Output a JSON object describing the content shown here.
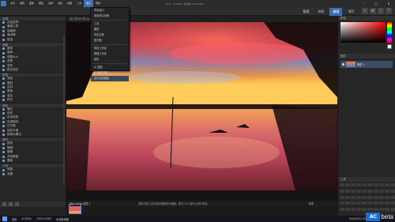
{
  "menu": {
    "items": [
      "文件",
      "编辑",
      "图像",
      "图层",
      "选择",
      "滤镜",
      "视图",
      "工具",
      "窗口",
      "帮助"
    ],
    "active_index": 8,
    "title": "ACD · ACDSee 专业版 2024 beta"
  },
  "window_controls": [
    "–",
    "□",
    "✕"
  ],
  "mode_tabs": [
    "管理",
    "冲印",
    "编辑",
    "365"
  ],
  "mode_active": 2,
  "left_panel": {
    "sections": [
      {
        "label": "选择",
        "rows": [
          "自由选择",
          "套索工具",
          "智能刷",
          "魔术棒",
          "框选"
        ]
      },
      {
        "label": "调整",
        "rows": [
          "裁剪",
          "旋转",
          "调整大小",
          "透视",
          "变形",
          "镜头校正"
        ]
      },
      {
        "label": "图层",
        "rows": [
          "添加",
          "复制",
          "合并",
          "蒙版",
          "混合",
          "样式"
        ]
      },
      {
        "label": "颜色",
        "rows": [
          "曝光",
          "色阶",
          "自动色阶",
          "色调曲线",
          "白平衡",
          "色彩平衡",
          "转换为黑白"
        ]
      },
      {
        "label": "细节",
        "rows": [
          "锐化",
          "降噪",
          "模糊",
          "去除雾霾",
          "晕影"
        ]
      },
      {
        "label": "几何",
        "rows": [
          "修复",
          "克隆"
        ]
      }
    ]
  },
  "window_menu": {
    "items": [
      "停靠窗口",
      "恢复默认布局",
      "工具",
      "图层",
      "历史记录",
      "直方图",
      "保存工作区",
      "管理工作区",
      "颜色",
      "Al 智能",
      "Al 面部识别",
      "显示全部面板"
    ]
  },
  "canvas": {
    "caption": "星空湖泊日落.jpg",
    "status_left": "显示 100%  图层 1",
    "status_mid": "选择左侧工具开始对图像进行编辑。按住 Ctrl 键可以进行多选。",
    "status_right": "完成"
  },
  "right_panel": {
    "color_header": "颜色",
    "layers_header": "图层",
    "layer_name": "图层 1",
    "tools_header": "工具"
  },
  "taskbar": {
    "items": [
      "搜索",
      "ACDSee",
      "1920×1080",
      "资源管理器"
    ],
    "time": "2024/4/12 21:37"
  },
  "brand": {
    "logo": "AC",
    "text": "beta"
  },
  "colors": {
    "accent": "#3c6fb0",
    "panel": "#262626",
    "sunset_top": "#b62a24",
    "sunset_glow": "#ff9a2a"
  }
}
